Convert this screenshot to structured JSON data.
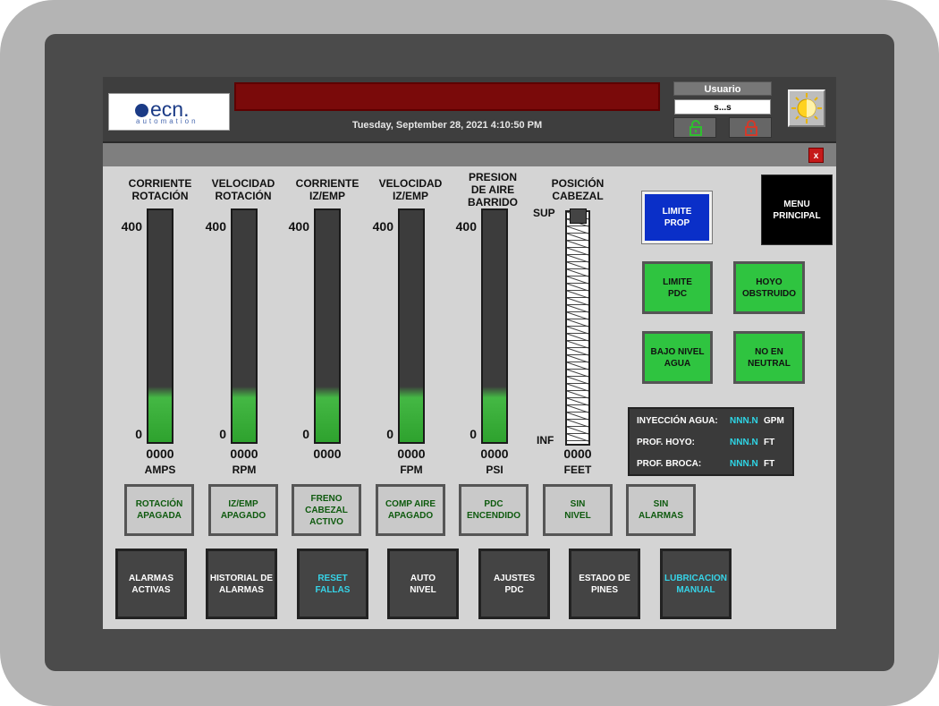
{
  "header": {
    "logo_text": "ecn.",
    "logo_sub": "automation",
    "datetime": "Tuesday, September 28, 2021 4:10:50 PM",
    "user_label": "Usuario",
    "user_value": "s...s",
    "close_label": "x"
  },
  "gauges": [
    {
      "title": "CORRIENTE\nROTACIÓN",
      "max": "400",
      "min": "0",
      "value": "0000",
      "unit": "AMPS",
      "fill_fraction": 0.24
    },
    {
      "title": "VELOCIDAD\nROTACIÓN",
      "max": "400",
      "min": "0",
      "value": "0000",
      "unit": "RPM",
      "fill_fraction": 0.24
    },
    {
      "title": "CORRIENTE\nIZ/EMP",
      "max": "400",
      "min": "0",
      "value": "0000",
      "unit": "",
      "fill_fraction": 0.24
    },
    {
      "title": "VELOCIDAD\nIZ/EMP",
      "max": "400",
      "min": "0",
      "value": "0000",
      "unit": "FPM",
      "fill_fraction": 0.24
    },
    {
      "title": "PRESION\nDE AIRE\nBARRIDO",
      "max": "400",
      "min": "0",
      "value": "0000",
      "unit": "PSI",
      "fill_fraction": 0.24
    }
  ],
  "position": {
    "title": "POSICIÓN\nCABEZAL",
    "top_label": "SUP",
    "bottom_label": "INF",
    "value": "0000",
    "unit": "FEET"
  },
  "indicators": {
    "limite_prop": "LIMITE\nPROP",
    "menu_principal": "MENU\nPRINCIPAL",
    "limite_pdc": "LIMITE\nPDC",
    "hoyo_obstruido": "HOYO\nOBSTRUIDO",
    "bajo_nivel_agua": "BAJO NIVEL\nAGUA",
    "no_en_neutral": "NO EN\nNEUTRAL"
  },
  "info": [
    {
      "label": "INYECCIÓN AGUA:",
      "value": "NNN.N",
      "unit": "GPM"
    },
    {
      "label": "PROF. HOYO:",
      "value": "NNN.N",
      "unit": "FT"
    },
    {
      "label": "PROF. BROCA:",
      "value": "NNN.N",
      "unit": "FT"
    }
  ],
  "status_buttons": [
    "ROTACIÓN\nAPAGADA",
    "IZ/EMP\nAPAGADO",
    "FRENO\nCABEZAL\nACTIVO",
    "COMP AIRE\nAPAGADO",
    "PDC\nENCENDIDO",
    "SIN\nNIVEL",
    "SIN\nALARMAS"
  ],
  "menu_buttons": [
    "ALARMAS\nACTIVAS",
    "HISTORIAL DE\nALARMAS",
    "RESET\nFALLAS",
    "AUTO\nNIVEL",
    "AJUSTES\nPDC",
    "ESTADO DE\nPINES",
    "LUBRICACION\nMANUAL"
  ],
  "colors": {
    "alarm_bar": "#7a0a0a",
    "indicator_green": "#2fc440",
    "indicator_blue": "#0a2fc8",
    "info_value": "#2ed6e6",
    "unlock_icon": "#2fbf2f",
    "lock_icon": "#d23a2a"
  },
  "icons": [
    "lock-open-icon",
    "lock-closed-icon",
    "brightness-icon",
    "close-icon"
  ]
}
